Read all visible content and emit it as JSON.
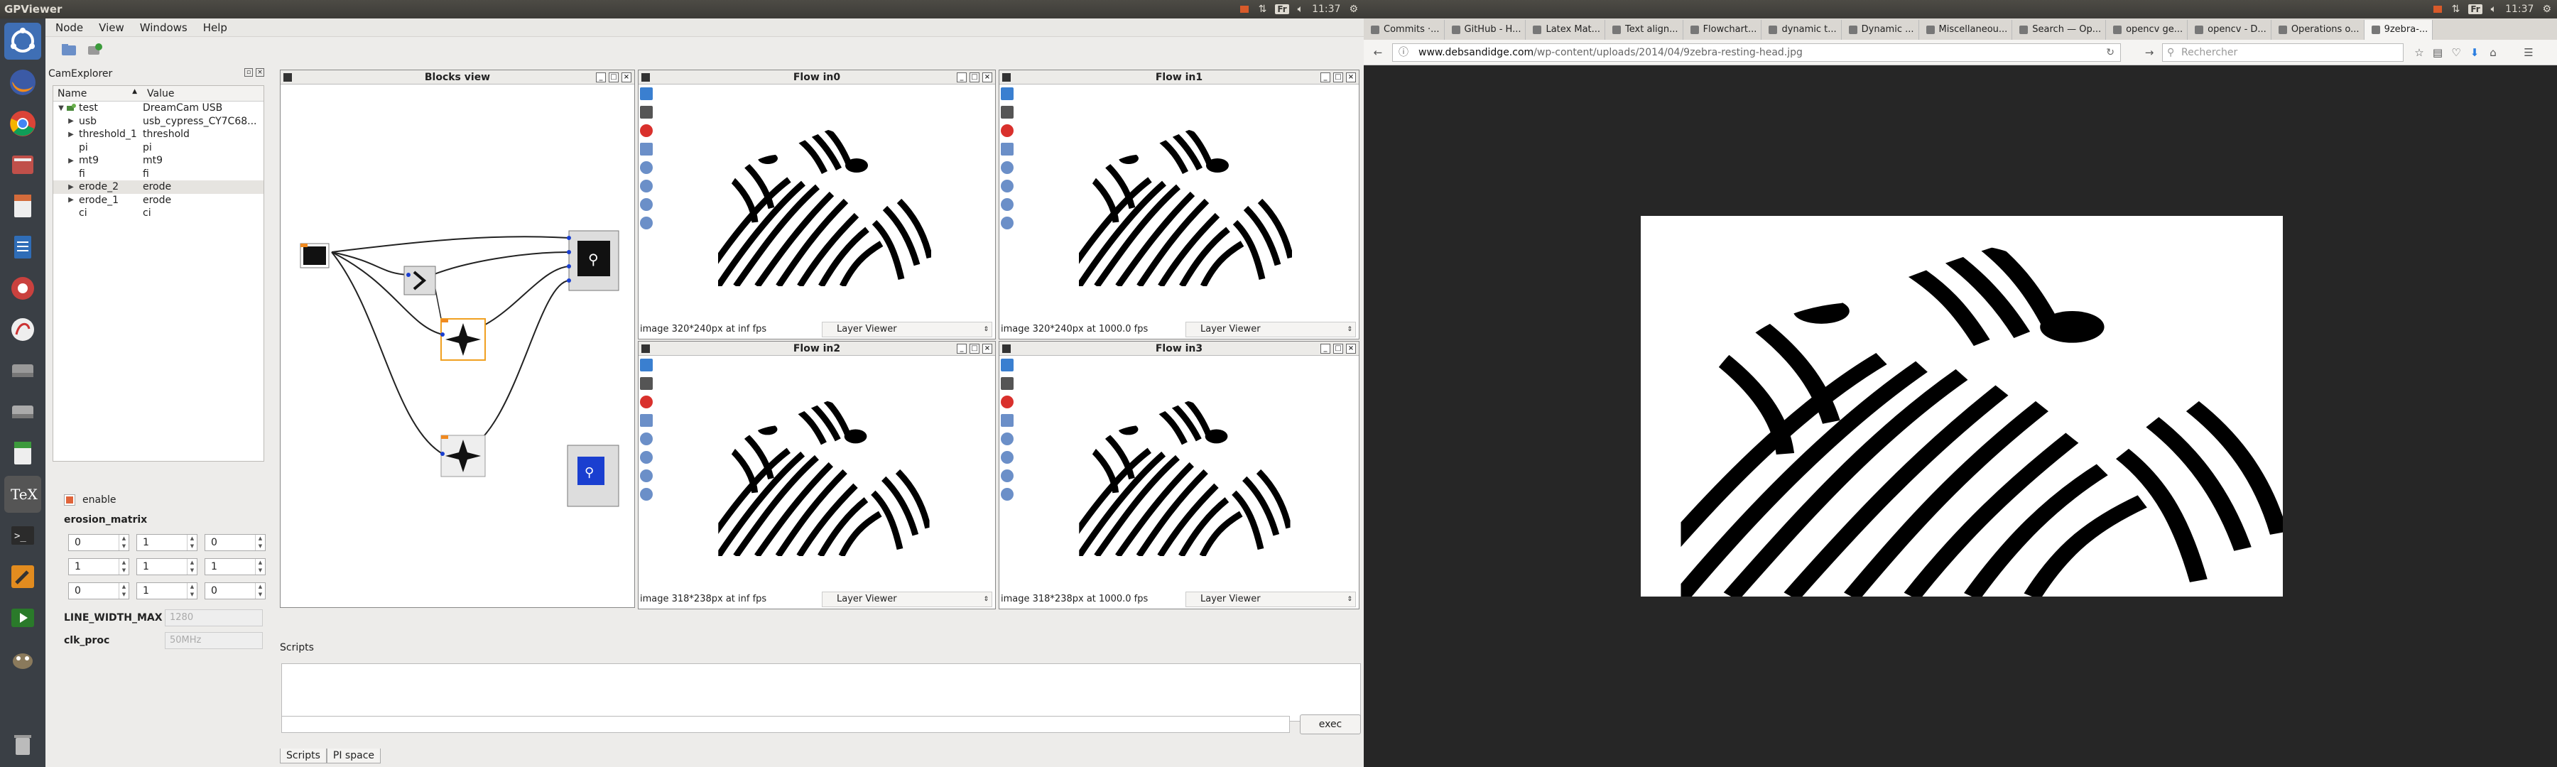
{
  "system": {
    "left_title": "GPViewer",
    "clock": "11:37",
    "kbd_layout": "Fr"
  },
  "launcher": {
    "items": [
      "ubuntu-dash-icon",
      "firefox-icon",
      "chrome-icon",
      "files-icon",
      "writer-icon",
      "document-icon",
      "settings-icon",
      "qt-creator-icon",
      "drive-icon",
      "drive2-icon",
      "calc-icon",
      "texmaker-icon",
      "terminal-icon",
      "tools-icon",
      "video-icon",
      "gimp-icon",
      "trash-icon"
    ]
  },
  "app": {
    "menu": [
      "Node",
      "View",
      "Windows",
      "Help"
    ],
    "camexplorer": {
      "title": "CamExplorer",
      "col_name": "Name",
      "col_value": "Value",
      "rows": [
        {
          "name": "test",
          "value": "DreamCam USB",
          "indent": 0,
          "arrow": "▼"
        },
        {
          "name": "usb",
          "value": "usb_cypress_CY7C68...",
          "indent": 1,
          "arrow": "▶"
        },
        {
          "name": "threshold_1",
          "value": "threshold",
          "indent": 1,
          "arrow": "▶"
        },
        {
          "name": "pi",
          "value": "pi",
          "indent": 1,
          "arrow": ""
        },
        {
          "name": "mt9",
          "value": "mt9",
          "indent": 1,
          "arrow": "▶"
        },
        {
          "name": "fi",
          "value": "fi",
          "indent": 1,
          "arrow": ""
        },
        {
          "name": "erode_2",
          "value": "erode",
          "indent": 1,
          "arrow": "▶",
          "selected": true
        },
        {
          "name": "erode_1",
          "value": "erode",
          "indent": 1,
          "arrow": "▶"
        },
        {
          "name": "ci",
          "value": "ci",
          "indent": 1,
          "arrow": ""
        }
      ]
    },
    "props": {
      "enable_label": "enable",
      "matrix_label": "erosion_matrix",
      "matrix": [
        [
          "0",
          "1",
          "0"
        ],
        [
          "1",
          "1",
          "1"
        ],
        [
          "0",
          "1",
          "0"
        ]
      ],
      "line_width_label": "LINE_WIDTH_MAX",
      "line_width_value": "1280",
      "clk_label": "clk_proc",
      "clk_value": "50MHz"
    },
    "blocks_view": {
      "title": "Blocks view"
    },
    "flows": [
      {
        "title": "Flow in0",
        "status": "image 320*240px at inf fps",
        "layer": "Layer Viewer"
      },
      {
        "title": "Flow in1",
        "status": "image 320*240px at 1000.0 fps",
        "layer": "Layer Viewer"
      },
      {
        "title": "Flow in2",
        "status": "image 318*238px at inf fps",
        "layer": "Layer Viewer"
      },
      {
        "title": "Flow in3",
        "status": "image 318*238px at 1000.0 fps",
        "layer": "Layer Viewer"
      }
    ],
    "scripts": {
      "title": "Scripts",
      "exec_label": "exec",
      "tabs": [
        "Scripts",
        "PI space"
      ]
    }
  },
  "browser": {
    "tabs": [
      "Commits ·...",
      "GitHub - H...",
      "Latex Mat...",
      "Text align...",
      "Flowchart...",
      "dynamic t...",
      "Dynamic ...",
      "Miscellaneou...",
      "Search — Op...",
      "opencv ge...",
      "opencv - D...",
      "Operations o...",
      "9zebra-..."
    ],
    "url_host": "www.debsandidge.com",
    "url_path": "/wp-content/uploads/2014/04/9zebra-resting-head.jpg",
    "search_placeholder": "Rechercher"
  },
  "colors": {
    "accent_orange": "#f0a020",
    "ubuntu_bar": "#3c3b37",
    "launcher_bg": "#3a3f45",
    "record_red": "#d9302c",
    "play_blue": "#3a7fd0"
  }
}
